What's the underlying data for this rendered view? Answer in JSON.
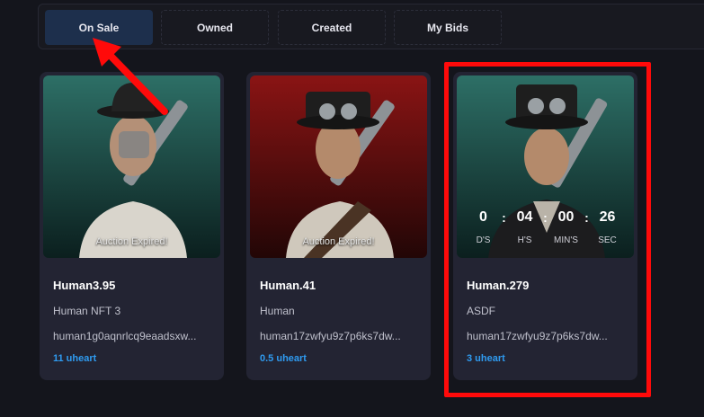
{
  "tabs": [
    {
      "label": "On Sale",
      "active": true
    },
    {
      "label": "Owned",
      "active": false
    },
    {
      "label": "Created",
      "active": false
    },
    {
      "label": "My Bids",
      "active": false
    }
  ],
  "cards": [
    {
      "title": "Human3.95",
      "description": "Human NFT 3",
      "owner": "human1g0aqnrlcq9eaadsxw...",
      "price": "11 uheart",
      "status": "Auction Expired!",
      "theme": "teal"
    },
    {
      "title": "Human.41",
      "description": "Human",
      "owner": "human17zwfyu9z7p6ks7dw...",
      "price": "0.5 uheart",
      "status": "Auction Expired!",
      "theme": "red"
    },
    {
      "title": "Human.279",
      "description": "ASDF",
      "owner": "human17zwfyu9z7p6ks7dw...",
      "price": "3 uheart",
      "theme": "teal",
      "timer": {
        "days": "0",
        "hours": "04",
        "minutes": "00",
        "seconds": "26",
        "days_label": "D'S",
        "hours_label": "H'S",
        "minutes_label": "MIN'S",
        "seconds_label": "SEC"
      }
    }
  ],
  "colors": {
    "accent": "#2f9bf0",
    "annotation": "#ff0a0a",
    "active_tab": "#1d2f4c"
  }
}
